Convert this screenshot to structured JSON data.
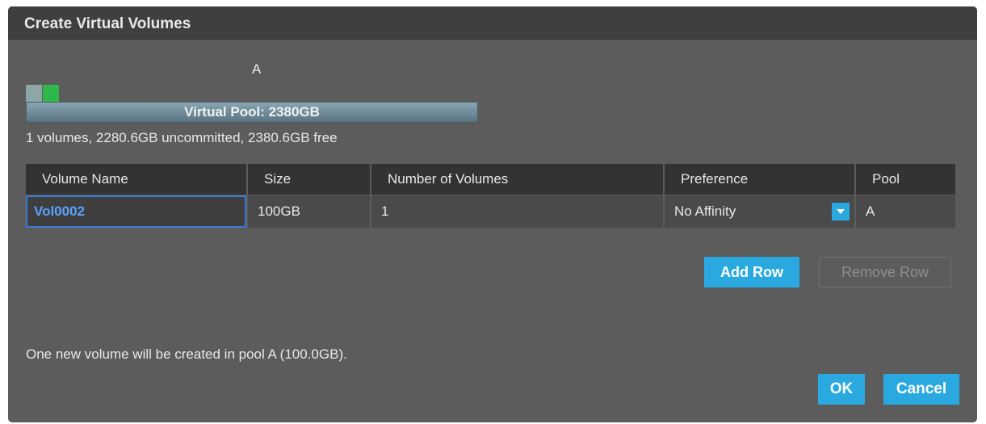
{
  "dialog": {
    "title": "Create Virtual Volumes"
  },
  "pool": {
    "label": "A",
    "bar_label": "Virtual Pool: 2380GB",
    "info": "1 volumes, 2280.6GB uncommitted, 2380.6GB free"
  },
  "table": {
    "headers": [
      "Volume Name",
      "Size",
      "Number of Volumes",
      "Preference",
      "Pool"
    ],
    "rows": [
      {
        "volume_name": "Vol0002",
        "size": "100GB",
        "count": "1",
        "preference": "No Affinity",
        "pool": "A"
      }
    ]
  },
  "buttons": {
    "add_row": "Add Row",
    "remove_row": "Remove Row",
    "ok": "OK",
    "cancel": "Cancel"
  },
  "summary": "One new volume will be created in pool A (100.0GB).",
  "colors": {
    "dialog_bg": "#5c5c5c",
    "titlebar_bg": "#3f3f3f",
    "accent": "#29a9e0",
    "pool_segment_used": "#8ea6a6",
    "pool_segment_new": "#2fb84a",
    "input_text": "#5aa0ff"
  },
  "icons": {
    "preference_dropdown": "chevron-down-icon"
  }
}
